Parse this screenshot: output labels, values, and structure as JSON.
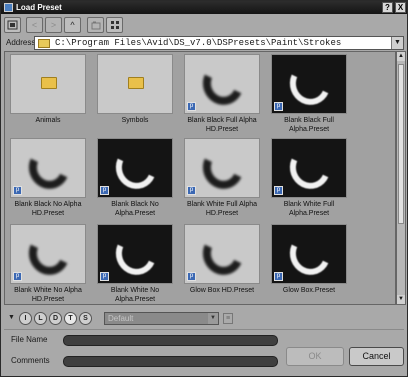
{
  "window": {
    "title": "Load Preset"
  },
  "titlebar": {
    "help_label": "?",
    "close_label": "X"
  },
  "address": {
    "label": "Address",
    "path": "C:\\Program Files\\Avid\\DS_v7.0\\DSPresets\\Paint\\Strokes"
  },
  "toolbar": {
    "buttons": [
      {
        "icon": "back-icon",
        "label": "<"
      },
      {
        "icon": "forward-icon",
        "label": ">"
      },
      {
        "icon": "up-icon",
        "label": "^"
      }
    ]
  },
  "items": [
    {
      "label": "Animals",
      "kind": "folder"
    },
    {
      "label": "Symbols",
      "kind": "folder"
    },
    {
      "label": "Blank Black Full Alpha HD.Preset",
      "kind": "soft"
    },
    {
      "label": "Blank Black Full Alpha.Preset",
      "kind": "light"
    },
    {
      "label": "Blank Black No Alpha HD.Preset",
      "kind": "soft"
    },
    {
      "label": "Blank Black No Alpha.Preset",
      "kind": "light"
    },
    {
      "label": "Blank White Full Alpha HD.Preset",
      "kind": "soft"
    },
    {
      "label": "Blank White Full Alpha.Preset",
      "kind": "light"
    },
    {
      "label": "Blank White No Alpha HD.Preset",
      "kind": "soft"
    },
    {
      "label": "Blank White No Alpha.Preset",
      "kind": "light"
    },
    {
      "label": "Glow Box HD.Preset",
      "kind": "soft"
    },
    {
      "label": "Glow Box.Preset",
      "kind": "light"
    }
  ],
  "filter": {
    "buttons": [
      "I",
      "L",
      "D",
      "T",
      "S"
    ],
    "active": "T",
    "dropdown_value": "Default"
  },
  "fields": {
    "file_name_label": "File Name",
    "file_name_value": "",
    "comments_label": "Comments",
    "comments_value": ""
  },
  "buttons": {
    "ok": "OK",
    "cancel": "Cancel"
  }
}
